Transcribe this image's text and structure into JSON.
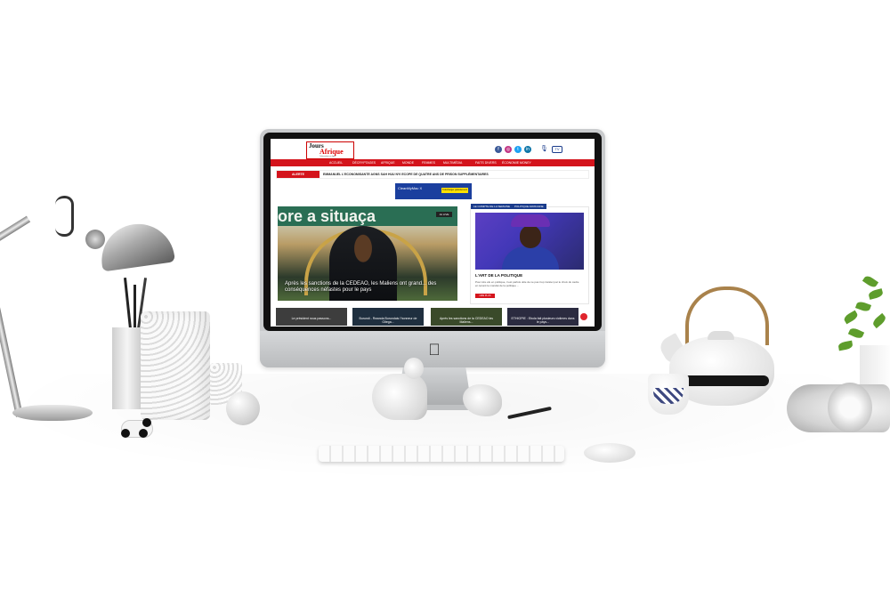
{
  "scene": {
    "objects": [
      "desk-lamp",
      "pencil-holder",
      "panda-figurine",
      "imac",
      "bird-figurine",
      "paper-ball",
      "pen",
      "keyboard",
      "mouse",
      "teapot",
      "teacup",
      "headphones",
      "plant"
    ]
  },
  "website": {
    "logo_top": "Jours",
    "logo_bottom": "Afrique",
    "logo_sub": "l'information en ligne",
    "social_icons": [
      "facebook-icon",
      "instagram-icon",
      "twitter-icon",
      "linkedin-icon",
      "mic-icon",
      "tv-icon"
    ],
    "nav": [
      "ACCUEIL",
      "DÉCRYPTAGES",
      "AFRIQUE",
      "MONDE",
      "FEMMES",
      "MULTIMÉDIA",
      "FAITS DIVERS",
      "ÉCONOMIE MONEY"
    ],
    "alert_label": "ALERTE",
    "alert_text": "EMMANUEL L'ECONOMISANTE AGNS SAH HUU NYI ECOPE DE QUATRE ANS DE PRISON SUPPLÉMENTAIRES",
    "ad_text": "CleanMyMac X",
    "ad_button": "Télécharger gratuitement",
    "hero_banner": "ore a situaça",
    "hero_tag": "JA LIVE",
    "hero_caption": "Après les sanctions de la CEDEAO, les Maliens ont grand... des conséquences néfastes pour le pays",
    "side_tabs": [
      "LE COMPTE DE LA SEMAINE",
      "POLITIQUE AFRICAINE"
    ],
    "side_title": "L'ART DE LA POLITIQUE",
    "side_text": "Pour être élu en politique, il est parfois utile de ne pas trop insister par le choix du cadre en tenant le mandat de la politique ...",
    "side_button": "LIRE PLUS",
    "thumbs": [
      {
        "caption": "Le président nous passons...",
        "color": "#3d3d3d"
      },
      {
        "caption": "Burundi - Rwanda Burundais l'honneur de Gitega...",
        "color": "#1f2f3f"
      },
      {
        "caption": "Après les sanctions de la CEDEAO les Maliens...",
        "color": "#3a4a2a"
      },
      {
        "caption": "ETHIOPIE : Ebola fait plusieurs victimes dans le pays...",
        "color": "#2b2b40"
      }
    ]
  },
  "colors": {
    "brand_red": "#d4141c",
    "nav_blue": "#1a3c8c"
  }
}
